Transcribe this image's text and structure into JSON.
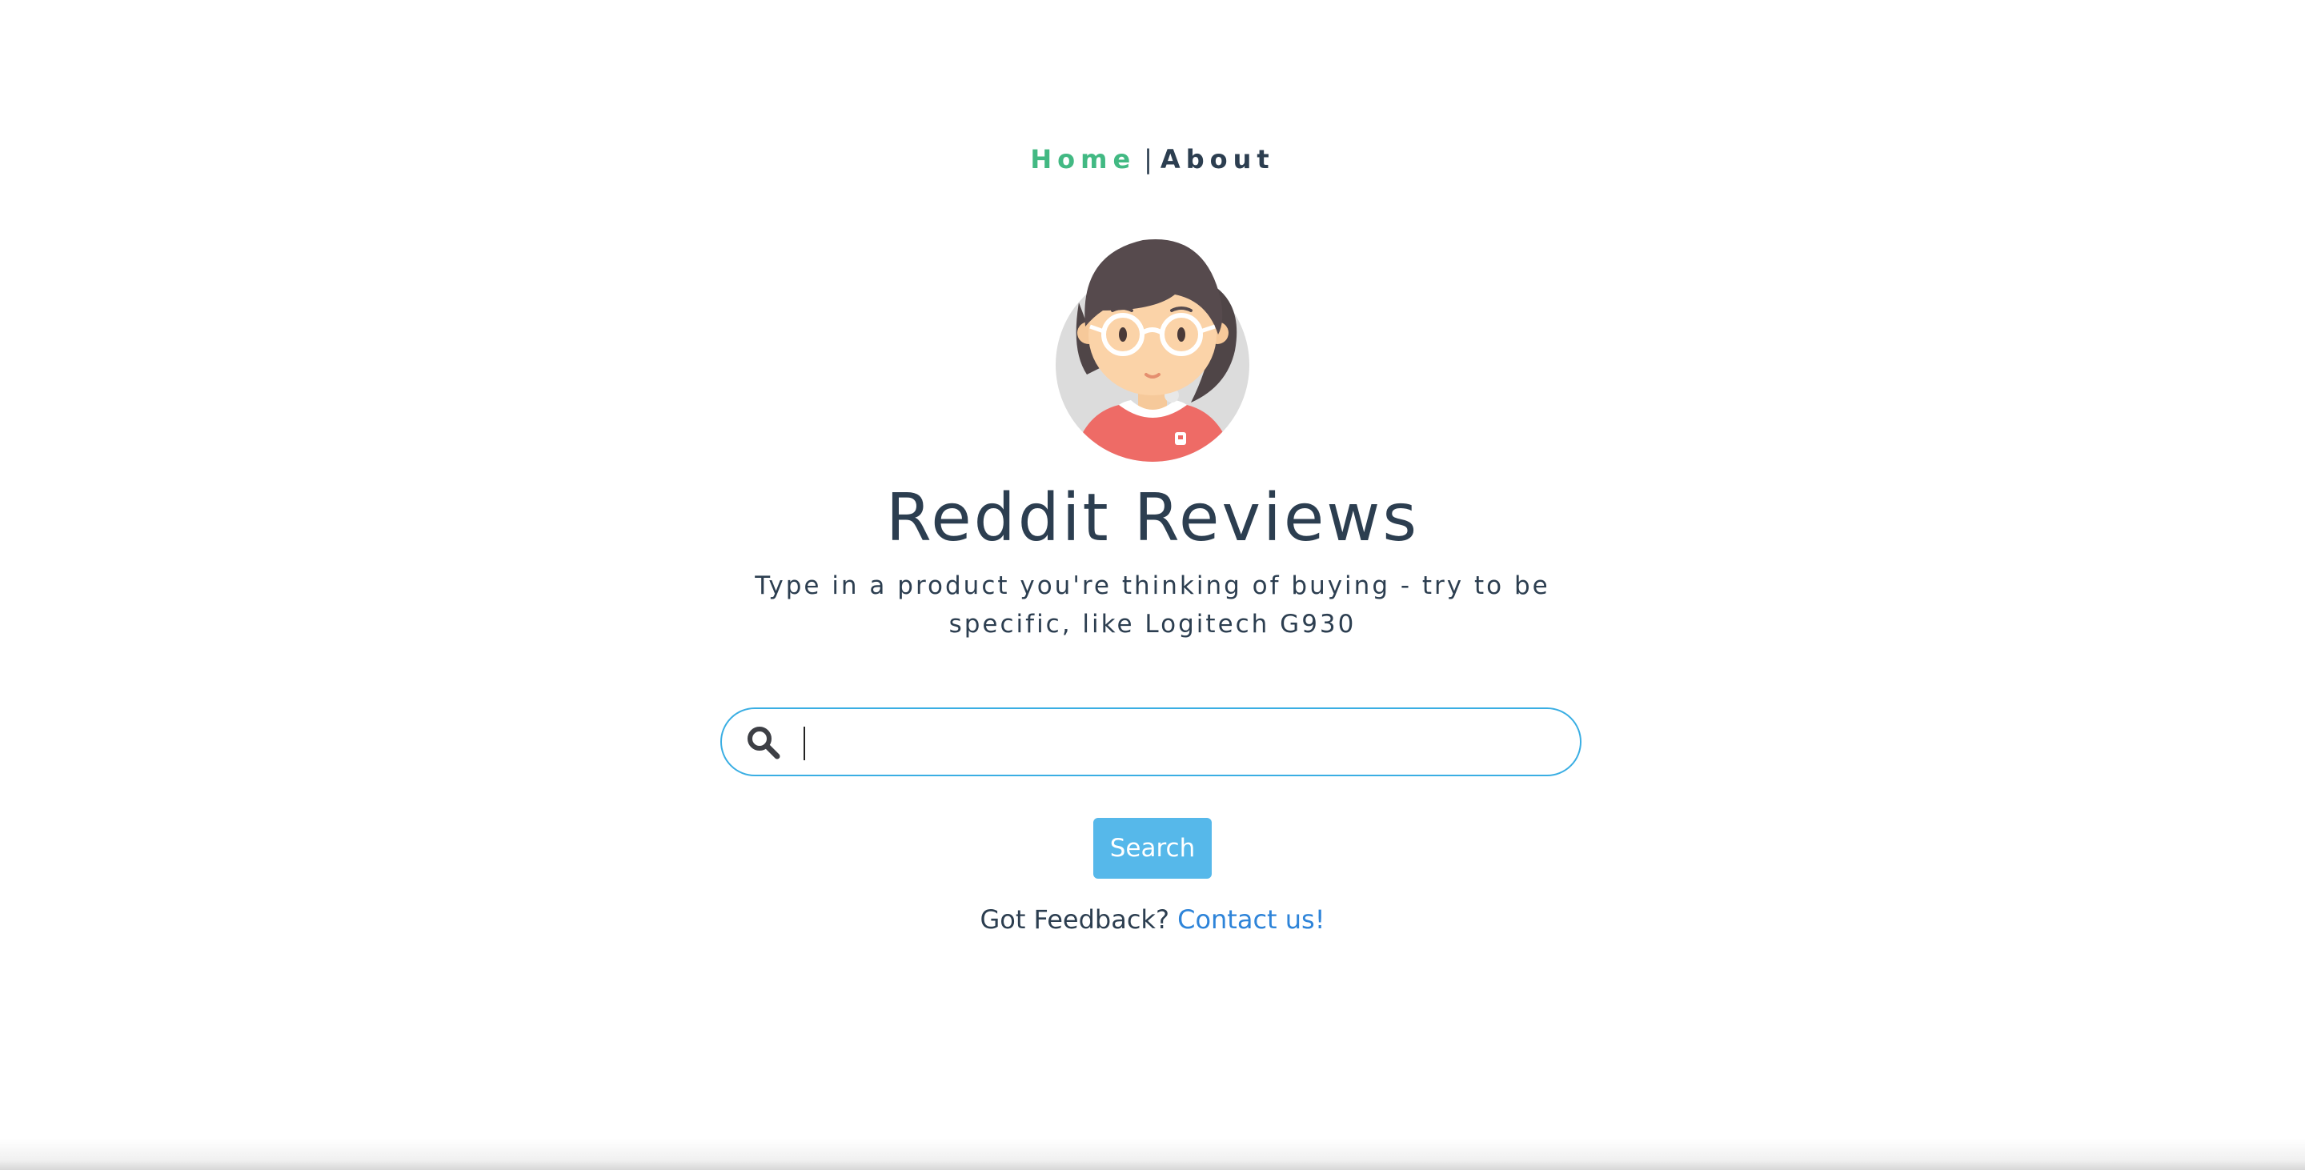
{
  "nav": {
    "home_label": "Home",
    "separator": "|",
    "about_label": "About"
  },
  "header": {
    "title": "Reddit Reviews",
    "subtitle": "Type in a product you're thinking of buying - try to be specific, like Logitech G930"
  },
  "search": {
    "icon": "search-icon",
    "value": "",
    "placeholder": "",
    "button_label": "Search"
  },
  "feedback": {
    "prefix": "Got Feedback?",
    "link_label": "Contact us!"
  },
  "colors": {
    "accent_green": "#42b983",
    "text_dark": "#2c3e50",
    "search_border": "#3aaee3",
    "button_bg": "#56b8ea",
    "link_blue": "#2e84d9"
  }
}
